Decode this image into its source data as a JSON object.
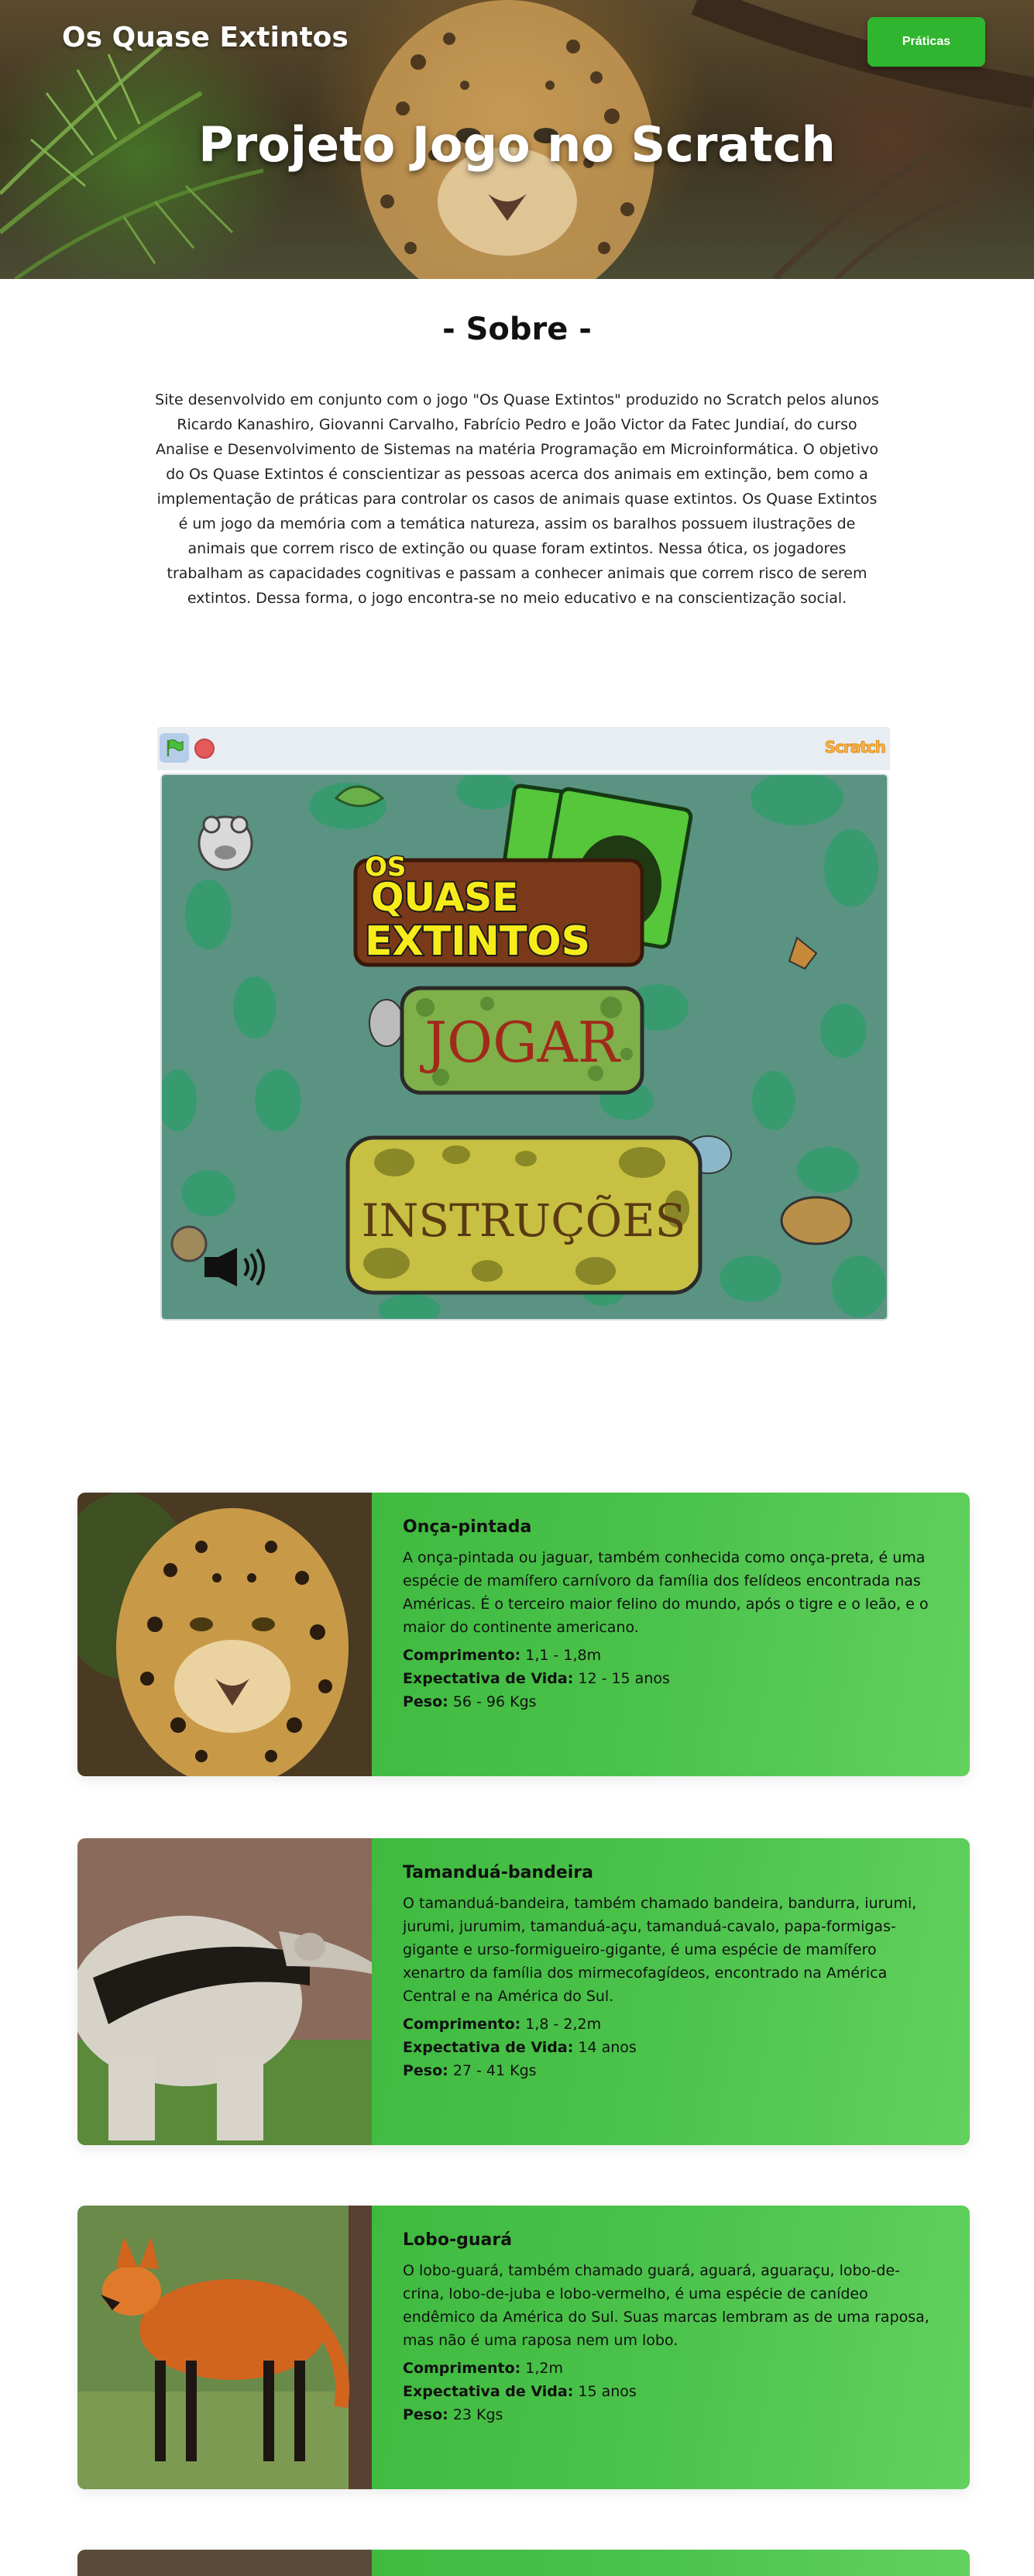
{
  "header": {
    "brand": "Os Quase Extintos",
    "nav_button": "Práticas",
    "title": "Projeto Jogo no Scratch"
  },
  "about": {
    "heading": "- Sobre -",
    "text": "Site desenvolvido em conjunto com o jogo \"Os Quase Extintos\" produzido no Scratch pelos alunos Ricardo Kanashiro, Giovanni Carvalho, Fabrício Pedro e João Victor da Fatec Jundiaí, do curso Analise e Desenvolvimento de Sistemas na matéria Programação em Microinformática. O objetivo do Os Quase Extintos é conscientizar as pessoas acerca dos animais em extinção, bem como a implementação de práticas para controlar os casos de animais quase extintos. Os Quase Extintos é um jogo da memória com a temática natureza, assim os baralhos possuem ilustrações de animais que correm risco de extinção ou quase foram extintos. Nessa ótica, os jogadores trabalham as capacidades cognitivas e passam a conhecer animais que correm risco de serem extintos. Dessa forma, o jogo encontra-se no meio educativo e na conscientização social."
  },
  "player": {
    "logo": "Scratch",
    "game_title_small": "OS",
    "game_title_line1": "QUASE",
    "game_title_line2": "EXTINTOS",
    "play_label": "JOGAR",
    "instructions_label": "INSTRUÇÕES",
    "icons": [
      "green-flag-icon",
      "stop-icon",
      "speaker-icon"
    ]
  },
  "animals": [
    {
      "name": "Onça-pintada",
      "description": "A onça-pintada ou jaguar, também conhecida como onça-preta, é uma espécie de mamífero carnívoro da família dos felídeos encontrada nas Américas. É o terceiro maior felino do mundo, após o tigre e o leão, e o maior do continente americano.",
      "length_label": "Comprimento:",
      "length": " 1,1 - 1,8m",
      "life_label": "Expectativa de Vida:",
      "life": " 12 - 15 anos",
      "weight_label": "Peso:",
      "weight": " 56 - 96 Kgs"
    },
    {
      "name": "Tamanduá-bandeira",
      "description": "O tamanduá-bandeira, também chamado bandeira, bandurra, iurumi, jurumi, jurumim, tamanduá-açu, tamanduá-cavalo, papa-formigas-gigante e urso-formigueiro-gigante, é uma espécie de mamífero xenartro da família dos mirmecofagídeos, encontrado na América Central e na América do Sul.",
      "length_label": "Comprimento:",
      "length": " 1,8 - 2,2m",
      "life_label": "Expectativa de Vida:",
      "life": " 14 anos",
      "weight_label": "Peso:",
      "weight": " 27 - 41 Kgs"
    },
    {
      "name": "Lobo-guará",
      "description": "O lobo-guará, também chamado guará, aguará, aguaraçu, lobo-de-crina, lobo-de-juba e lobo-vermelho, é uma espécie de canídeo endêmico da América do Sul. Suas marcas lembram as de uma raposa, mas não é uma raposa nem um lobo.",
      "length_label": "Comprimento:",
      "length": " 1,2m",
      "life_label": "Expectativa de Vida:",
      "life": " 15 anos",
      "weight_label": "Peso:",
      "weight": " 23 Kgs"
    }
  ],
  "colors": {
    "accent_green": "#2fb52f",
    "card_green": "#4cc34c",
    "stage_teal": "#5b9382"
  }
}
